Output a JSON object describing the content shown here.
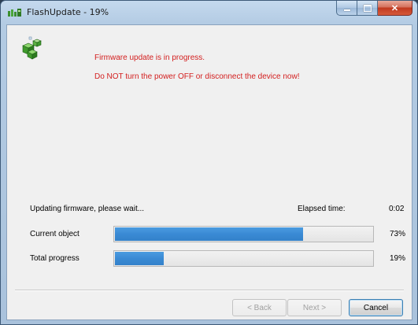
{
  "window": {
    "title": "FlashUpdate - 19%",
    "icons": {
      "title": "flashupdate-app-icon",
      "content": "green-cubes-icon"
    }
  },
  "caption_buttons": {
    "minimize": "minimize-icon",
    "maximize": "maximize-icon",
    "close": "✕"
  },
  "message": {
    "line1": "Firmware update is in progress.",
    "line2": "Do NOT turn the power OFF or disconnect the device now!",
    "color": "#d31f1f"
  },
  "status": {
    "text": "Updating firmware, please wait...",
    "elapsed_label": "Elapsed time:",
    "elapsed_value": "0:02"
  },
  "progress": {
    "current": {
      "label": "Current object",
      "percent": 73,
      "percent_text": "73%"
    },
    "total": {
      "label": "Total progress",
      "percent": 19,
      "percent_text": "19%"
    },
    "fill_color": "#3a8ad4"
  },
  "buttons": {
    "back": "< Back",
    "next": "Next >",
    "cancel": "Cancel"
  }
}
